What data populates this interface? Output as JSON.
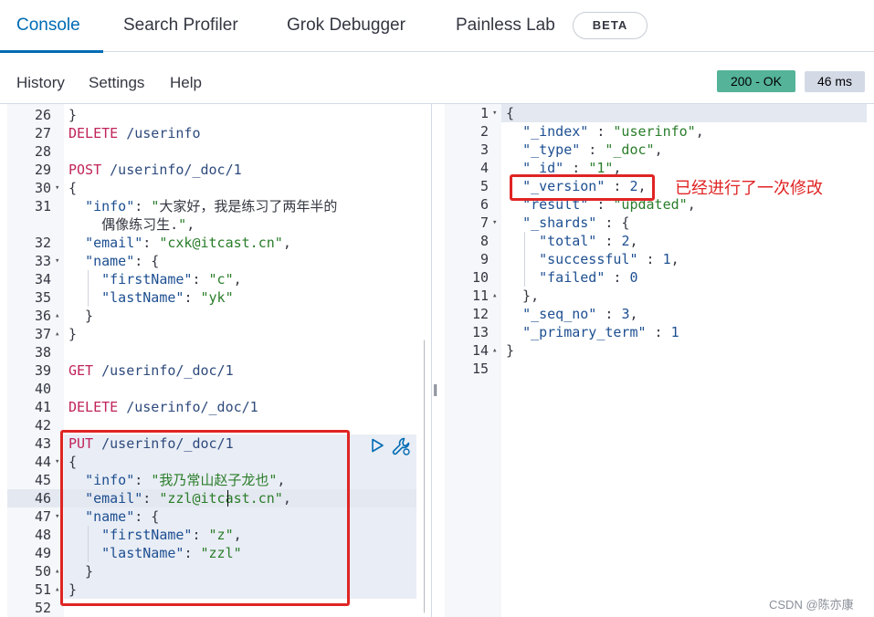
{
  "tabs": [
    {
      "label": "Console",
      "active": true
    },
    {
      "label": "Search Profiler"
    },
    {
      "label": "Grok Debugger"
    },
    {
      "label": "Painless Lab"
    }
  ],
  "beta_badge": "BETA",
  "subnav": {
    "history": "History",
    "settings": "Settings",
    "help": "Help"
  },
  "status": {
    "code": "200 - OK",
    "time": "46 ms"
  },
  "colors": {
    "accent": "#006bb4",
    "ok": "#54b399",
    "annotation": "#e02424"
  },
  "request_lines": [
    {
      "n": "26",
      "fold": "",
      "code": "}"
    },
    {
      "n": "27",
      "fold": "",
      "code": "DELETE /userinfo"
    },
    {
      "n": "28",
      "fold": "",
      "code": ""
    },
    {
      "n": "29",
      "fold": "",
      "code": "POST /userinfo/_doc/1"
    },
    {
      "n": "30",
      "fold": "▾",
      "code": "{"
    },
    {
      "n": "31",
      "fold": "",
      "code": "  \"info\": \"大家好，我是练习了两年半的"
    },
    {
      "n": "",
      "fold": "",
      "code": "    偶像练习生.\","
    },
    {
      "n": "32",
      "fold": "",
      "code": "  \"email\": \"cxk@itcast.cn\","
    },
    {
      "n": "33",
      "fold": "▾",
      "code": "  \"name\": {"
    },
    {
      "n": "34",
      "fold": "",
      "code": "    \"firstName\": \"c\","
    },
    {
      "n": "35",
      "fold": "",
      "code": "    \"lastName\": \"yk\""
    },
    {
      "n": "36",
      "fold": "▴",
      "code": "  }"
    },
    {
      "n": "37",
      "fold": "▴",
      "code": "}"
    },
    {
      "n": "38",
      "fold": "",
      "code": ""
    },
    {
      "n": "39",
      "fold": "",
      "code": "GET /userinfo/_doc/1"
    },
    {
      "n": "40",
      "fold": "",
      "code": ""
    },
    {
      "n": "41",
      "fold": "",
      "code": "DELETE /userinfo/_doc/1"
    },
    {
      "n": "42",
      "fold": "",
      "code": ""
    },
    {
      "n": "43",
      "fold": "",
      "code": "PUT /userinfo/_doc/1"
    },
    {
      "n": "44",
      "fold": "▾",
      "code": "{"
    },
    {
      "n": "45",
      "fold": "",
      "code": "  \"info\": \"我乃常山赵子龙也\","
    },
    {
      "n": "46",
      "fold": "",
      "code": "  \"email\": \"zzl@itcast.cn\","
    },
    {
      "n": "47",
      "fold": "▾",
      "code": "  \"name\": {"
    },
    {
      "n": "48",
      "fold": "",
      "code": "    \"firstName\": \"z\","
    },
    {
      "n": "49",
      "fold": "",
      "code": "    \"lastName\": \"zzl\""
    },
    {
      "n": "50",
      "fold": "▴",
      "code": "  }"
    },
    {
      "n": "51",
      "fold": "▴",
      "code": "}"
    },
    {
      "n": "52",
      "fold": "",
      "code": ""
    }
  ],
  "response_lines": [
    {
      "n": "1",
      "fold": "▾",
      "code": "{"
    },
    {
      "n": "2",
      "fold": "",
      "code": "  \"_index\" : \"userinfo\","
    },
    {
      "n": "3",
      "fold": "",
      "code": "  \"_type\" : \"_doc\","
    },
    {
      "n": "4",
      "fold": "",
      "code": "  \"_id\" : \"1\","
    },
    {
      "n": "5",
      "fold": "",
      "code": "  \"_version\" : 2,"
    },
    {
      "n": "6",
      "fold": "",
      "code": "  \"result\" : \"updated\","
    },
    {
      "n": "7",
      "fold": "▾",
      "code": "  \"_shards\" : {"
    },
    {
      "n": "8",
      "fold": "",
      "code": "    \"total\" : 2,"
    },
    {
      "n": "9",
      "fold": "",
      "code": "    \"successful\" : 1,"
    },
    {
      "n": "10",
      "fold": "",
      "code": "    \"failed\" : 0"
    },
    {
      "n": "11",
      "fold": "▴",
      "code": "  },"
    },
    {
      "n": "12",
      "fold": "",
      "code": "  \"_seq_no\" : 3,"
    },
    {
      "n": "13",
      "fold": "",
      "code": "  \"_primary_term\" : 1"
    },
    {
      "n": "14",
      "fold": "▴",
      "code": "}"
    },
    {
      "n": "15",
      "fold": "",
      "code": ""
    }
  ],
  "annotation": "已经进行了一次修改",
  "watermark": "CSDN @陈亦康",
  "icons": {
    "run": "play-icon",
    "settings": "wrench-icon"
  }
}
